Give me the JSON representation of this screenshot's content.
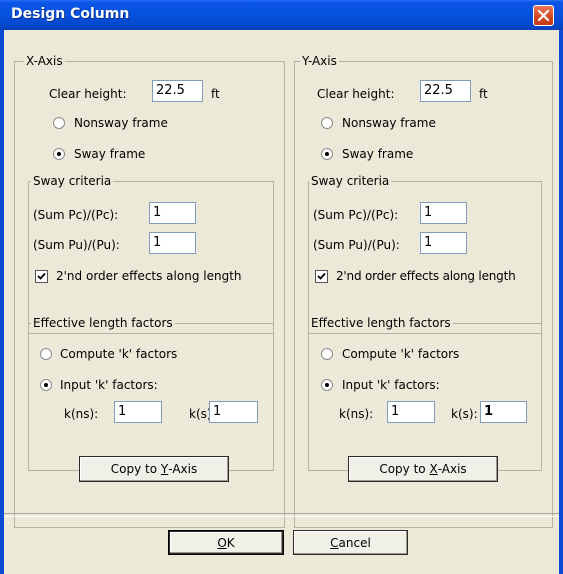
{
  "window": {
    "title": "Design Column"
  },
  "x_axis": {
    "group_label": "X-Axis",
    "clear_height_label": "Clear height:",
    "clear_height_value": "22.5",
    "clear_height_unit": "ft",
    "nonsway_label": "Nonsway frame",
    "sway_label": "Sway frame",
    "selected_frame": "sway",
    "sway_criteria": {
      "label": "Sway criteria",
      "pc_label": "(Sum Pc)/(Pc):",
      "pc_value": "1",
      "pu_label": "(Sum Pu)/(Pu):",
      "pu_value": "1",
      "second_order_label": "2'nd order effects along length",
      "second_order_checked": true
    },
    "effective_length": {
      "label": "Effective length factors",
      "compute_label": "Compute 'k' factors",
      "input_label": "Input 'k' factors:",
      "selected": "input",
      "kns_label": "k(ns):",
      "kns_value": "1",
      "ks_label": "k(s):",
      "ks_value": "1"
    },
    "copy_button_prefix": "Copy to ",
    "copy_button_mnemonic": "Y",
    "copy_button_suffix": "-Axis"
  },
  "y_axis": {
    "group_label": "Y-Axis",
    "clear_height_label": "Clear height:",
    "clear_height_value": "22.5",
    "clear_height_unit": "ft",
    "nonsway_label": "Nonsway frame",
    "sway_label": "Sway frame",
    "selected_frame": "sway",
    "sway_criteria": {
      "label": "Sway criteria",
      "pc_label": "(Sum Pc)/(Pc):",
      "pc_value": "1",
      "pu_label": "(Sum Pu)/(Pu):",
      "pu_value": "1",
      "second_order_label": "2'nd order effects along length",
      "second_order_checked": true
    },
    "effective_length": {
      "label": "Effective length factors",
      "compute_label": "Compute 'k' factors",
      "input_label": "Input 'k' factors:",
      "selected": "input",
      "kns_label": "k(ns):",
      "kns_value": "1",
      "ks_label": "k(s):",
      "ks_value": "1"
    },
    "copy_button_prefix": "Copy to ",
    "copy_button_mnemonic": "X",
    "copy_button_suffix": "-Axis"
  },
  "footer": {
    "ok_mnemonic": "O",
    "ok_rest": "K",
    "cancel_mnemonic": "C",
    "cancel_rest": "ancel"
  }
}
